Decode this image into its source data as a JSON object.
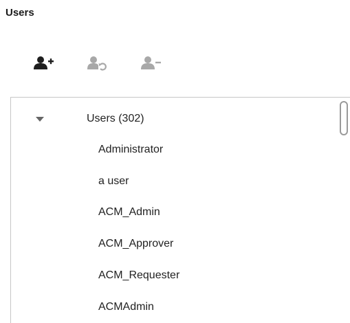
{
  "section": {
    "title": "Users"
  },
  "toolbar": {
    "items": [
      {
        "icon": "add-user-icon",
        "enabled": true,
        "color": "#1e1e1e"
      },
      {
        "icon": "refresh-user-icon",
        "enabled": false,
        "color": "#a8a8a8"
      },
      {
        "icon": "remove-user-icon",
        "enabled": false,
        "color": "#a8a8a8"
      }
    ]
  },
  "tree": {
    "root": {
      "label": "Users (302)",
      "expanded": true,
      "icon": "caret-down-icon"
    },
    "children": [
      {
        "label": "Administrator"
      },
      {
        "label": "a user"
      },
      {
        "label": "ACM_Admin"
      },
      {
        "label": "ACM_Approver"
      },
      {
        "label": "ACM_Requester"
      },
      {
        "label": "ACMAdmin"
      }
    ]
  },
  "colors": {
    "border": "#c6c6c6",
    "text": "#222222",
    "disabled": "#a8a8a8"
  }
}
